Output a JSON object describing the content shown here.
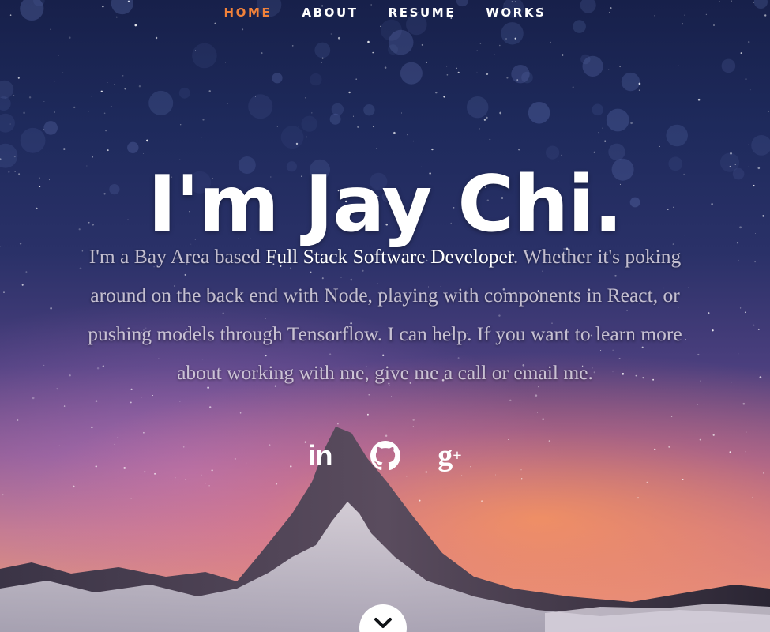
{
  "nav": {
    "items": [
      {
        "label": "HOME",
        "active": true
      },
      {
        "label": "ABOUT",
        "active": false
      },
      {
        "label": "RESUME",
        "active": false
      },
      {
        "label": "WORKS",
        "active": false
      }
    ],
    "active_color": "#f0813a"
  },
  "hero": {
    "title": "I'm Jay Chi.",
    "bio": {
      "line1_pre": "I'm a Bay Area based ",
      "line1_highlight": "Full Stack Software Developer",
      "line1_post": ". Whether it's poking",
      "line2": "around on the back end with Node, playing with components in React, or",
      "line3": "pushing models through Tensorflow. I can help. If you want to learn more",
      "line4": "about working with me, give me a call or email me."
    }
  },
  "social": {
    "linkedin": {
      "icon": "linkedin-icon",
      "text": "in"
    },
    "github": {
      "icon": "github-icon"
    },
    "googleplus": {
      "icon": "google-plus-icon",
      "text": "g",
      "plus": "+"
    }
  },
  "scroll_button": {
    "icon": "chevron-down-icon"
  }
}
